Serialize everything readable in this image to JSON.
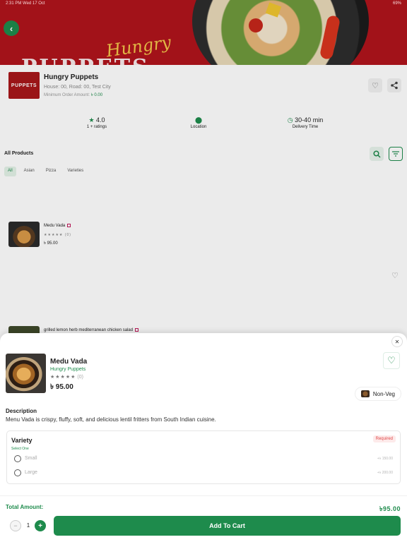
{
  "status_bar": {
    "left": "2:31 PM  Wed 17 Oct",
    "right": "69%"
  },
  "banner": {
    "script_text": "Hungry",
    "big_text": "PUPPETS"
  },
  "restaurant": {
    "logo_text": "PUPPETS",
    "name": "Hungry Puppets",
    "address": "House: 00, Road: 00, Test City",
    "min_order_label": "Minimum Order Amount:",
    "min_order_value": "৳ 0.00",
    "rating": "4.0",
    "ratings_count": "1 + ratings",
    "location_label": "Location",
    "delivery_time": "30-40 min",
    "delivery_label": "Delivery Time"
  },
  "products": {
    "heading": "All Products",
    "categories": [
      "All",
      "Asian",
      "Pizza",
      "Varieties"
    ],
    "items": [
      {
        "name": "Medu Vada",
        "stars": "★★★★★",
        "rating_count": "(0)",
        "price": "৳ 95.00"
      },
      {
        "name": "grilled lemon herb mediterranean chicken salad"
      }
    ]
  },
  "sheet": {
    "item_name": "Medu Vada",
    "restaurant": "Hungry Puppets",
    "stars": "★★★★★",
    "rating_count": "(0)",
    "price": "৳ 95.00",
    "tag": "Non-Veg",
    "description_title": "Description",
    "description": "Menu Vada is crispy, fluffy, soft, and delicious lentil fritters from South Indian cuisine.",
    "variety": {
      "title": "Variety",
      "subtitle": "Select One",
      "required": "Required",
      "options": [
        {
          "label": "Small",
          "price": "+৳ 150.00"
        },
        {
          "label": "Large",
          "price": "+৳ 200.00"
        }
      ]
    },
    "total_label": "Total Amount:",
    "total_value": "৳95.00",
    "quantity": "1",
    "add_to_cart": "Add To Cart"
  },
  "colors": {
    "brand_green": "#1e8b4c",
    "banner_red": "#b0141c",
    "required_red": "#e04848"
  }
}
